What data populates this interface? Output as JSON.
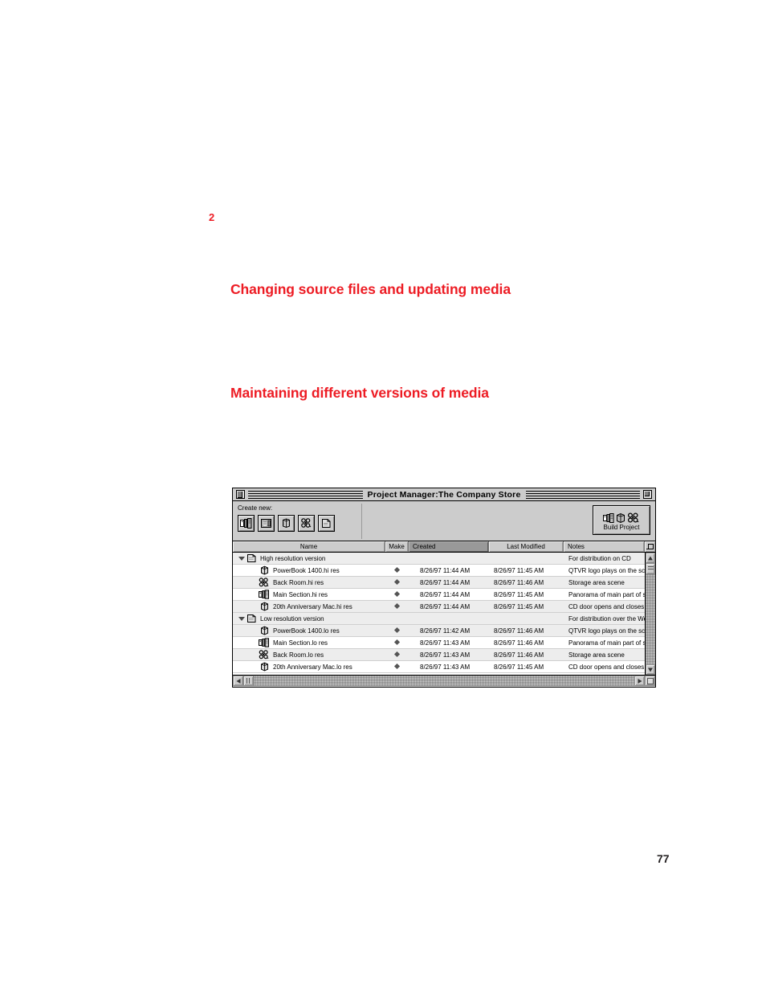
{
  "document": {
    "chapter_number": "2",
    "heading_1": "Changing source files and updating media",
    "heading_2": "Maintaining different versions of media",
    "page_number": "77",
    "heading_color": "#ed1c24"
  },
  "window": {
    "title": "Project Manager:The Company Store",
    "close_box": "close-box",
    "zoom_box": "zoom-box"
  },
  "toolbar": {
    "create_label": "Create new:",
    "buttons": [
      {
        "name": "new-panorama-button",
        "icon": "panorama-icon"
      },
      {
        "name": "new-scene-button",
        "icon": "scene-icon"
      },
      {
        "name": "new-object-button",
        "icon": "object-icon"
      },
      {
        "name": "new-node-link-button",
        "icon": "node-link-icon"
      },
      {
        "name": "new-folder-button",
        "icon": "folder-icon"
      }
    ],
    "build": {
      "label": "Build Project",
      "icons": [
        "panorama-icon",
        "object-icon",
        "node-link-icon"
      ]
    }
  },
  "table": {
    "columns": [
      {
        "label": "Name",
        "sorted": false
      },
      {
        "label": "Make",
        "sorted": false
      },
      {
        "label": "Created",
        "sorted": true
      },
      {
        "label": "Last Modified",
        "sorted": false
      },
      {
        "label": "Notes",
        "sorted": false
      }
    ],
    "sort_column": "Created",
    "rows": [
      {
        "type": "group",
        "expanded": true,
        "icon": "folder-icon",
        "name": "High resolution version",
        "make": "",
        "created": "",
        "modified": "",
        "notes": "For distribution on CD"
      },
      {
        "type": "file",
        "icon": "object-icon",
        "name": "PowerBook 1400.hi res",
        "make": "♦",
        "created": "8/26/97 11:44 AM",
        "modified": "8/26/97 11:45 AM",
        "notes": "QTVR logo plays on the screen"
      },
      {
        "type": "file",
        "icon": "node-link-icon",
        "name": "Back Room.hi res",
        "make": "♦",
        "created": "8/26/97 11:44 AM",
        "modified": "8/26/97 11:46 AM",
        "notes": "Storage area scene"
      },
      {
        "type": "file",
        "icon": "panorama-icon",
        "name": "Main Section.hi res",
        "make": "♦",
        "created": "8/26/97 11:44 AM",
        "modified": "8/26/97 11:45 AM",
        "notes": "Panorama of main part of store"
      },
      {
        "type": "file",
        "icon": "object-icon",
        "name": "20th Anniversary Mac.hi res",
        "make": "♦",
        "created": "8/26/97 11:44 AM",
        "modified": "8/26/97 11:45 AM",
        "notes": "CD door opens and closes"
      },
      {
        "type": "group",
        "expanded": true,
        "icon": "folder-icon",
        "name": "Low resolution version",
        "make": "",
        "created": "",
        "modified": "",
        "notes": "For distribution over the Web"
      },
      {
        "type": "file",
        "icon": "object-icon",
        "name": "PowerBook 1400.lo res",
        "make": "♦",
        "created": "8/26/97 11:42 AM",
        "modified": "8/26/97 11:46 AM",
        "notes": "QTVR logo plays on the screen"
      },
      {
        "type": "file",
        "icon": "panorama-icon",
        "name": "Main Section.lo res",
        "make": "♦",
        "created": "8/26/97 11:43 AM",
        "modified": "8/26/97 11:46 AM",
        "notes": "Panorama of main part of store"
      },
      {
        "type": "file",
        "icon": "node-link-icon",
        "name": "Back Room.lo res",
        "make": "♦",
        "created": "8/26/97 11:43 AM",
        "modified": "8/26/97 11:46 AM",
        "notes": "Storage area scene"
      },
      {
        "type": "file",
        "icon": "object-icon",
        "name": "20th Anniversary Mac.lo res",
        "make": "♦",
        "created": "8/26/97 11:43 AM",
        "modified": "8/26/97 11:45 AM",
        "notes": "CD door opens and closes"
      }
    ]
  },
  "scrollbars": {
    "vertical": {
      "up": "scroll-up-arrow",
      "down": "scroll-down-arrow"
    },
    "horizontal": {
      "left": "scroll-left-arrow",
      "right": "scroll-right-arrow"
    }
  }
}
